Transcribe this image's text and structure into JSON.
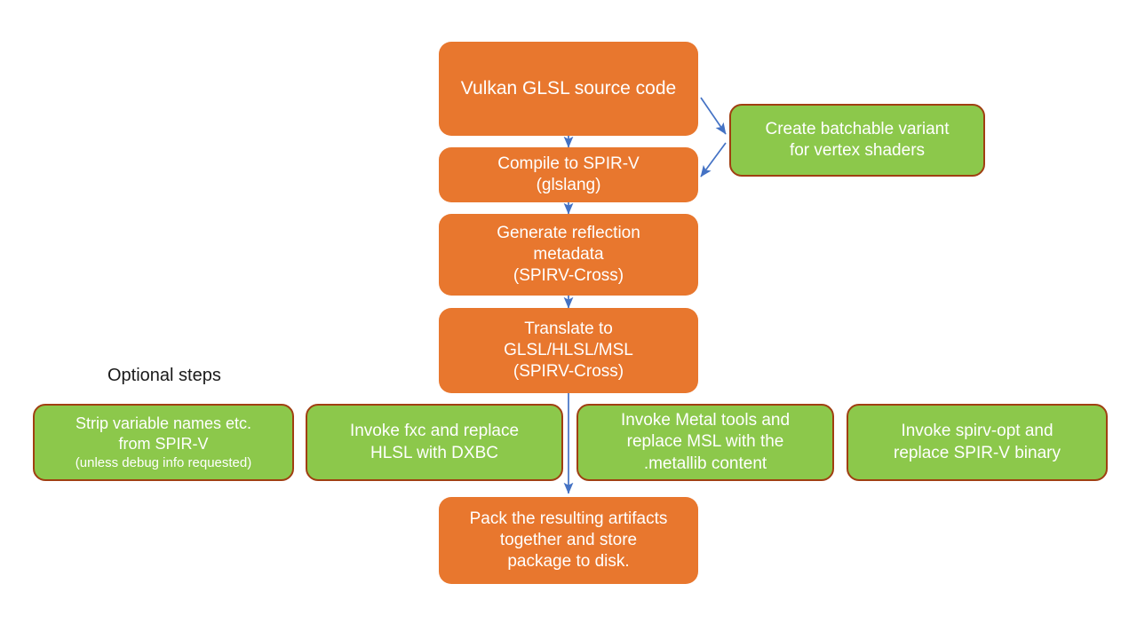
{
  "diagram": {
    "title_label": "Optional steps",
    "colors": {
      "orange_fill": "#E8772E",
      "green_fill": "#8CC84B",
      "green_border": "#A03F12",
      "arrow": "#4472C4",
      "text_on_node": "#FFFFFF",
      "label_text": "#1A1A1A"
    },
    "nodes": [
      {
        "id": "vulkan-glsl-source-code",
        "type": "orange",
        "lines": [
          "Vulkan GLSL source code"
        ],
        "font_size": 21
      },
      {
        "id": "compile-to-spirv",
        "type": "orange",
        "lines": [
          "Compile to SPIR-V",
          "(glslang)"
        ],
        "font_size": 19
      },
      {
        "id": "generate-reflection-metadata",
        "type": "orange",
        "lines": [
          "Generate reflection",
          "metadata",
          "(SPIRV-Cross)"
        ],
        "font_size": 19
      },
      {
        "id": "translate-to-glsl-hlsl-msl",
        "type": "orange",
        "lines": [
          "Translate to",
          "GLSL/HLSL/MSL",
          "(SPIRV-Cross)"
        ],
        "font_size": 19
      },
      {
        "id": "create-batchable-variant",
        "type": "green",
        "lines": [
          "Create batchable variant",
          "for vertex shaders"
        ],
        "font_size": 19
      },
      {
        "id": "strip-variable-names",
        "type": "green",
        "lines": [
          "Strip variable names etc.",
          "from SPIR-V",
          "(unless debug info requested)"
        ],
        "font_size": 18
      },
      {
        "id": "invoke-fxc-replace-hlsl",
        "type": "green",
        "lines": [
          "Invoke fxc and replace",
          "HLSL with DXBC"
        ],
        "font_size": 19
      },
      {
        "id": "invoke-metal-tools",
        "type": "green",
        "lines": [
          "Invoke Metal tools and",
          "replace MSL with the",
          ".metallib content"
        ],
        "font_size": 19
      },
      {
        "id": "invoke-spirv-opt",
        "type": "green",
        "lines": [
          "Invoke spirv-opt and",
          "replace SPIR-V binary"
        ],
        "font_size": 19
      },
      {
        "id": "pack-resulting-artifacts",
        "type": "orange",
        "lines": [
          "Pack the resulting artifacts",
          "together and store",
          "package to disk."
        ],
        "font_size": 19
      }
    ]
  }
}
